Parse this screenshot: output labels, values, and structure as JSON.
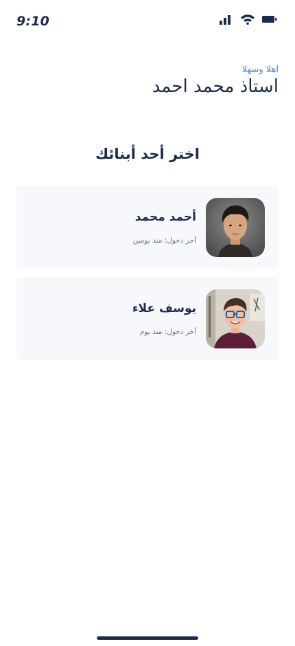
{
  "status_bar": {
    "time": "9:10",
    "icons": [
      "cellular-signal-icon",
      "wifi-icon",
      "battery-icon"
    ]
  },
  "header": {
    "welcome": "اهلا وسهلا",
    "teacher_name": "استاذ محمد احمد"
  },
  "main": {
    "title": "اختر أحد أبنائك",
    "children": [
      {
        "name": "أحمد محمد",
        "last_login": "آخر دخول: منذ يومين"
      },
      {
        "name": "يوسف علاء",
        "last_login": "آخر دخول: منذ يوم"
      }
    ]
  },
  "colors": {
    "text_primary": "#1d2b4a",
    "accent_blue": "#4a84c4",
    "card_background": "#f7f8fb",
    "text_muted": "#6b7385"
  }
}
